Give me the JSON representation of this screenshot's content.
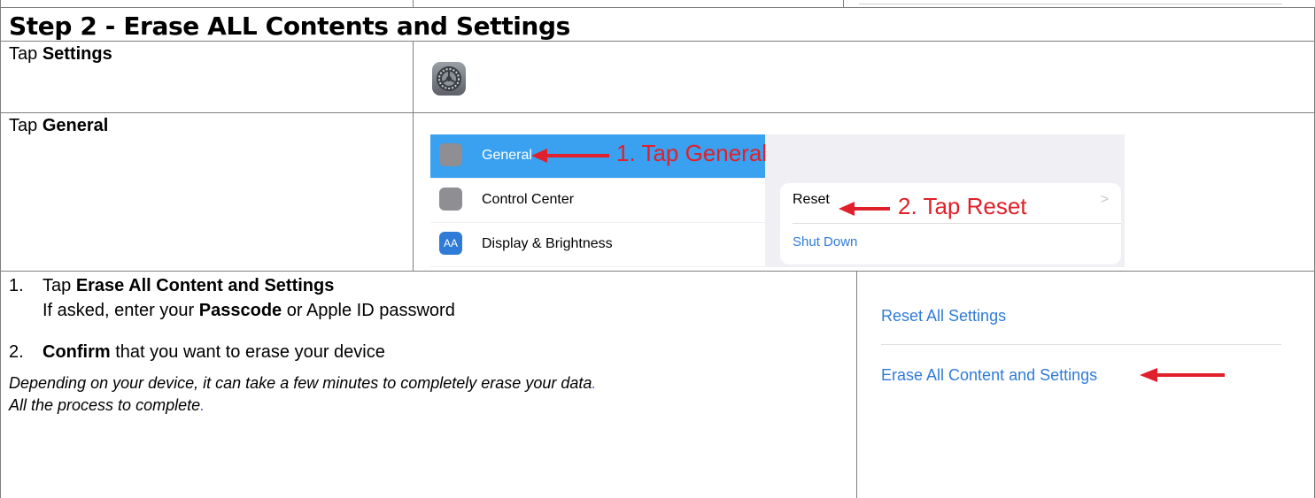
{
  "title": "Step 2 - Erase ALL Contents and Settings",
  "rows": {
    "settings": {
      "pre": "Tap ",
      "bold": "Settings"
    },
    "general": {
      "pre": "Tap ",
      "bold": "General"
    }
  },
  "general_shot": {
    "item_general": "General",
    "ann1": "1. Tap General",
    "item_control": "Control Center",
    "item_display": "Display & Brightness",
    "icon_display_text": "AA",
    "reset": "Reset",
    "ann2": "2. Tap Reset",
    "shutdown": "Shut Down",
    "chevron": ">"
  },
  "steps": {
    "s1_num": "1.",
    "s1_pre": "Tap ",
    "s1_bold": "Erase All Content and Settings",
    "s1b_pre": "If asked, enter your ",
    "s1b_bold": "Passcode",
    "s1b_post": " or Apple ID password",
    "s2_num": "2.",
    "s2_bold": "Confirm",
    "s2_post": " that you want to erase your device",
    "note1": "Depending on your device, it can take a few minutes to completely erase your data",
    "note1_dot": ".",
    "note2": "All the process to complete",
    "note2_dot": "."
  },
  "erase_shot": {
    "reset_all": "Reset All Settings",
    "erase_all": "Erase All Content and Settings"
  },
  "colors": {
    "border": "#7f7f7f",
    "link": "#2f7bd8",
    "annotation": "#e0202a",
    "selected": "#3aa0f0"
  }
}
